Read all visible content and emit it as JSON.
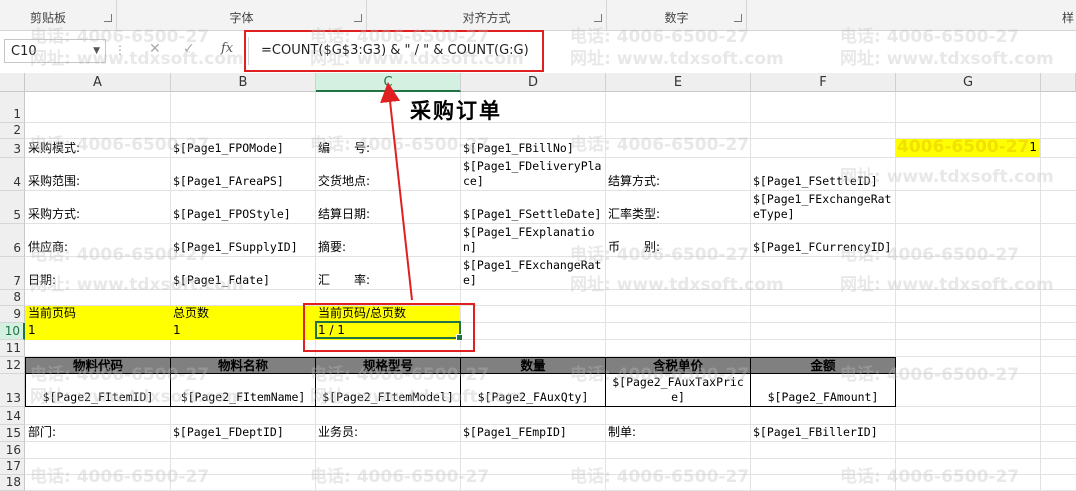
{
  "ribbon": {
    "groups": [
      {
        "label": "剪贴板"
      },
      {
        "label": "字体"
      },
      {
        "label": "对齐方式"
      },
      {
        "label": "数字"
      }
    ],
    "right_cut": "样"
  },
  "formula_bar": {
    "name_box": "C10",
    "cancel_icon": "✕",
    "enter_icon": "✓",
    "fx_label": "fx",
    "formula": "=COUNT($G$3:G3) & \" / \" & COUNT(G:G)"
  },
  "columns": [
    "A",
    "B",
    "C",
    "D",
    "E",
    "F",
    "G"
  ],
  "rows": [
    "1",
    "2",
    "3",
    "4",
    "5",
    "6",
    "7",
    "8",
    "9",
    "10",
    "11",
    "12",
    "13",
    "14",
    "15",
    "16",
    "17",
    "18"
  ],
  "sheet": {
    "title": "采购订单",
    "r3": {
      "a": "采购模式:",
      "b": "$[Page1_FPOMode]",
      "c": "编　　号:",
      "d": "$[Page1_FBillNo]",
      "g": "1"
    },
    "r4": {
      "a": "采购范围:",
      "b": "$[Page1_FAreaPS]",
      "c": "交货地点:",
      "d": "$[Page1_FDeliveryPlace]",
      "e": "结算方式:",
      "f": "$[Page1_FSettleID]"
    },
    "r5": {
      "a": "采购方式:",
      "b": "$[Page1_FPOStyle]",
      "c": "结算日期:",
      "d": "$[Page1_FSettleDate]",
      "e": "汇率类型:",
      "f": "$[Page1_FExchangeRateType]"
    },
    "r6": {
      "a": "供应商:",
      "b": "$[Page1_FSupplyID]",
      "c": "摘要:",
      "d": "$[Page1_FExplanation]",
      "e": "币　　别:",
      "f": "$[Page1_FCurrencyID]"
    },
    "r7": {
      "a": "日期:",
      "b": "$[Page1_Fdate]",
      "c": "汇　　率:",
      "d": "$[Page1_FExchangeRate]"
    },
    "r9": {
      "a": "当前页码",
      "b": "总页数",
      "c": "当前页码/总页数"
    },
    "r10": {
      "a": "1",
      "b": "1",
      "c": "1 / 1"
    },
    "table_headers": [
      "物料代码",
      "物料名称",
      "规格型号",
      "数量",
      "含税单价",
      "金额"
    ],
    "table_row": [
      "$[Page2_FItemID]",
      "$[Page2_FItemName]",
      "$[Page2_FItemModel]",
      "$[Page2_FAuxQty]",
      "$[Page2_FAuxTaxPrice]",
      "$[Page2_FAmount]"
    ],
    "r15": {
      "a": "部门:",
      "b": "$[Page1_FDeptID]",
      "c": "业务员:",
      "d": "$[Page1_FEmpID]",
      "e": "制单:",
      "f": "$[Page1_FBillerID]"
    }
  },
  "watermarks": {
    "phone": "电话: 4006-6500-27",
    "site": "网址: www.tdxsoft.com",
    "phone_cut": "4006-6500-27"
  },
  "colors": {
    "highlight": "#ffff00",
    "annotation": "#e02020",
    "excel_green": "#217346",
    "table_header": "#808080"
  }
}
